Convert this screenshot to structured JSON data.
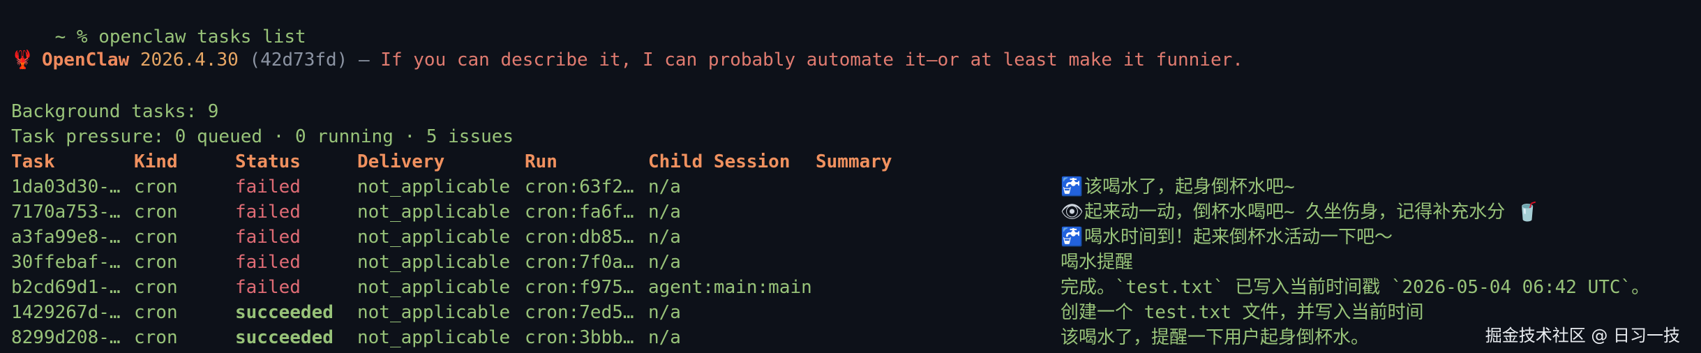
{
  "command": {
    "prompt": "~ %",
    "text": "openclaw tasks list"
  },
  "banner": {
    "icon": "lobster-icon",
    "icon_glyph": "🦞",
    "name": "OpenClaw",
    "version": "2026.4.30",
    "commit": "(42d73fd)",
    "dash": "—",
    "tagline": "If you can describe it, I can probably automate it—or at least make it funnier."
  },
  "stats": {
    "background": "Background tasks: 9",
    "pressure": "Task pressure: 0 queued · 0 running · 5 issues"
  },
  "table": {
    "headers": {
      "task": "Task",
      "kind": "Kind",
      "status": "Status",
      "delivery": "Delivery",
      "run": "Run",
      "child": "Child Session",
      "summary": "Summary"
    },
    "rows": [
      {
        "task": "1da03d30-…",
        "kind": "cron",
        "status": "failed",
        "delivery": "not_applicable",
        "run": "cron:63f2…",
        "child": "n/a",
        "summary_icon": "faucet-icon",
        "summary_glyph": "🚰",
        "summary": "该喝水了，起身倒杯水吧~",
        "summary_tail_icon": "",
        "summary_tail_glyph": ""
      },
      {
        "task": "7170a753-…",
        "kind": "cron",
        "status": "failed",
        "delivery": "not_applicable",
        "run": "cron:fa6f…",
        "child": "n/a",
        "summary_icon": "eye-icon",
        "summary_glyph": "👁",
        "summary": "起来动一动，倒杯水喝吧~ 久坐伤身，记得补充水分",
        "summary_tail_icon": "cup-icon",
        "summary_tail_glyph": "🥤"
      },
      {
        "task": "a3fa99e8-…",
        "kind": "cron",
        "status": "failed",
        "delivery": "not_applicable",
        "run": "cron:db85…",
        "child": "n/a",
        "summary_icon": "faucet-icon",
        "summary_glyph": "🚰",
        "summary": "喝水时间到！起来倒杯水活动一下吧～",
        "summary_tail_icon": "",
        "summary_tail_glyph": ""
      },
      {
        "task": "30ffebaf-…",
        "kind": "cron",
        "status": "failed",
        "delivery": "not_applicable",
        "run": "cron:7f0a…",
        "child": "n/a",
        "summary_icon": "",
        "summary_glyph": "",
        "summary": "喝水提醒",
        "summary_tail_icon": "",
        "summary_tail_glyph": ""
      },
      {
        "task": "b2cd69d1-…",
        "kind": "cron",
        "status": "failed",
        "delivery": "not_applicable",
        "run": "cron:f975…",
        "child": "agent:main:main",
        "summary_icon": "",
        "summary_glyph": "",
        "summary": "完成。`test.txt` 已写入当前时间戳 `2026-05-04 06:42 UTC`。",
        "summary_tail_icon": "",
        "summary_tail_glyph": ""
      },
      {
        "task": "1429267d-…",
        "kind": "cron",
        "status": "succeeded",
        "delivery": "not_applicable",
        "run": "cron:7ed5…",
        "child": "n/a",
        "summary_icon": "",
        "summary_glyph": "",
        "summary": "创建一个 test.txt 文件，并写入当前时间",
        "summary_tail_icon": "",
        "summary_tail_glyph": ""
      },
      {
        "task": "8299d208-…",
        "kind": "cron",
        "status": "succeeded",
        "delivery": "not_applicable",
        "run": "cron:3bbb…",
        "child": "n/a",
        "summary_icon": "",
        "summary_glyph": "",
        "summary": "该喝水了，提醒一下用户起身倒杯水。",
        "summary_tail_icon": "",
        "summary_tail_glyph": ""
      }
    ]
  },
  "watermark": "掘金技术社区 @ 日习一技",
  "colors": {
    "background": "#0d1119",
    "text_green": "#98c379",
    "header_orange": "#f0915f",
    "failed_red": "#e06c75",
    "tagline_red": "#e07b70"
  }
}
